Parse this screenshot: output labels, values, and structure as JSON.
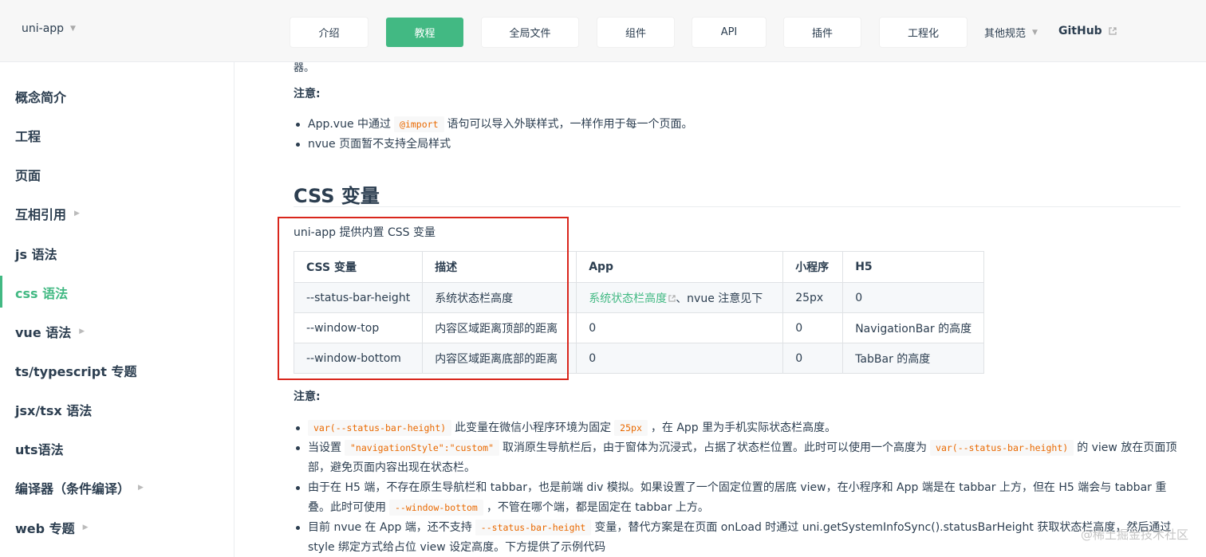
{
  "navbar": {
    "brand": "uni-app",
    "buttons": [
      "介绍",
      "教程",
      "全局文件",
      "组件",
      "API",
      "插件",
      "工程化"
    ],
    "active_button": "教程",
    "more_label": "其他规范",
    "github_label": "GitHub"
  },
  "sidebar": {
    "items": [
      "概念简介",
      "工程",
      "页面",
      "互相引用",
      "js 语法",
      "css 语法",
      "vue 语法",
      "ts/typescript 专题",
      "jsx/tsx 语法",
      "uts语法",
      "编译器（条件编译）",
      "web 专题"
    ],
    "active_item": "css 语法",
    "expandable_items": [
      "互相引用",
      "vue 语法",
      "编译器（条件编译）",
      "web 专题"
    ]
  },
  "content": {
    "cut_text": "器。",
    "note_label": "注意:",
    "note1_bullets": [
      {
        "before": "App.vue 中通过",
        "code": "@import",
        "after": "语句可以导入外联样式，一样作用于每一个页面。"
      },
      {
        "before": "nvue 页面暂不支持全局样式",
        "code": "",
        "after": ""
      }
    ],
    "section_title": "CSS 变量",
    "intro": "uni-app 提供内置 CSS 变量",
    "table": {
      "headers": [
        "CSS 变量",
        "描述",
        "App",
        "小程序",
        "H5"
      ],
      "rows": [
        {
          "var": "--status-bar-height",
          "desc": "系统状态栏高度",
          "app_link": "系统状态栏高度",
          "app_rest": "、nvue 注意见下",
          "mp": "25px",
          "h5": "0"
        },
        {
          "var": "--window-top",
          "desc": "内容区域距离顶部的距离",
          "app_link": "",
          "app_rest": "0",
          "mp": "0",
          "h5": "NavigationBar 的高度"
        },
        {
          "var": "--window-bottom",
          "desc": "内容区域距离底部的距离",
          "app_link": "",
          "app_rest": "0",
          "mp": "0",
          "h5": "TabBar 的高度"
        }
      ]
    },
    "note2_label": "注意:",
    "note2_bullets": {
      "b1_code1": "var(--status-bar-height)",
      "b1_text1": "此变量在微信小程序环境为固定",
      "b1_code2": "25px",
      "b1_text2": "，在 App 里为手机实际状态栏高度。",
      "b2_text1": "当设置",
      "b2_code1": "\"navigationStyle\":\"custom\"",
      "b2_text2": "取消原生导航栏后，由于窗体为沉浸式，占据了状态栏位置。此时可以使用一个高度为",
      "b2_code2": "var(--status-bar-height)",
      "b2_text3": "的 view 放在页面顶部，避免页面内容出现在状态栏。",
      "b3_text1": "由于在 H5 端，不存在原生导航栏和 tabbar，也是前端 div 模拟。如果设置了一个固定位置的居底 view，在小程序和 App 端是在 tabbar 上方，但在 H5 端会与 tabbar 重叠。此时可使用",
      "b3_code1": "--window-bottom",
      "b3_text2": "，不管在哪个端，都是固定在 tabbar 上方。",
      "b4_text1": "目前 nvue 在 App 端，还不支持",
      "b4_code1": "--status-bar-height",
      "b4_text2": "变量，替代方案是在页面 onLoad 时通过 uni.getSystemInfoSync().statusBarHeight 获取状态栏高度，然后通过 style 绑定方式给占位 view 设定高度。下方提供了示例代码"
    }
  },
  "watermark": "@稀土掘金技术社区",
  "colors": {
    "accent": "#42b983",
    "code": "#e96900",
    "highlight_box": "#d9261c"
  }
}
